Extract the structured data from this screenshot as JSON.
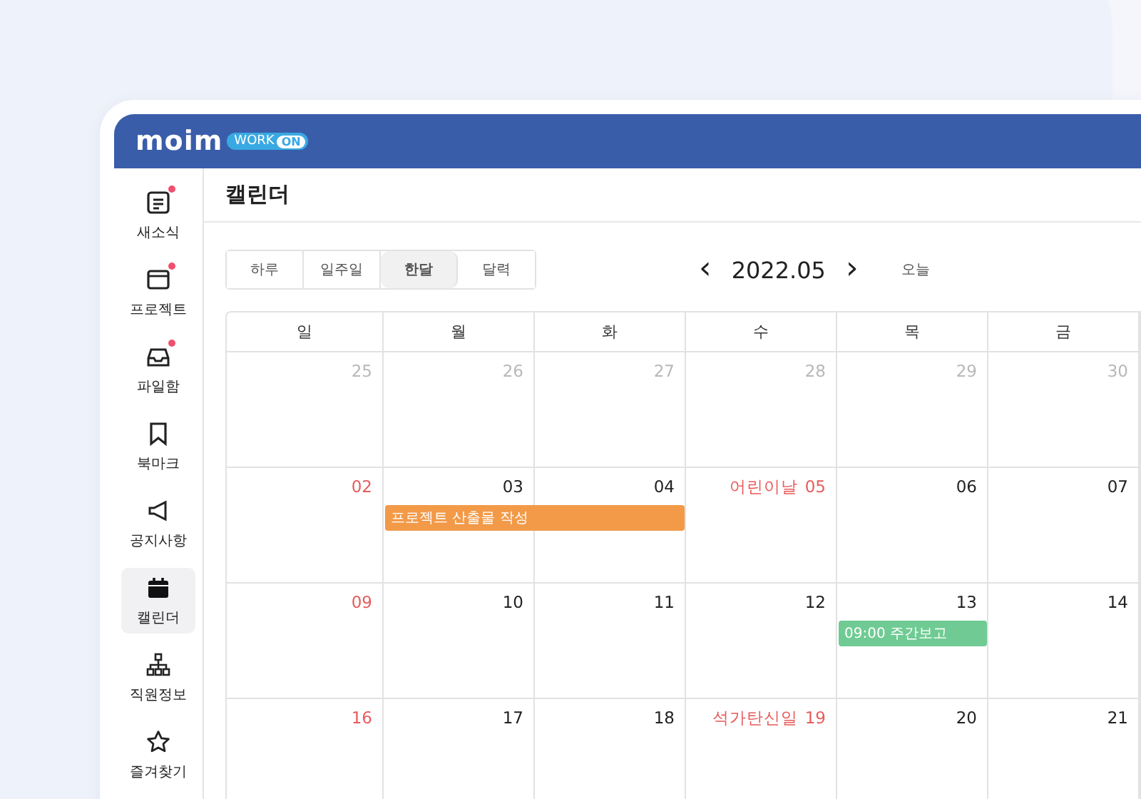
{
  "brand": {
    "name": "moim",
    "tag": "WORK",
    "tag_badge": "ON"
  },
  "sidebar": {
    "items": [
      {
        "label": "새소식",
        "badge": true,
        "selected": false
      },
      {
        "label": "프로젝트",
        "badge": true,
        "selected": false
      },
      {
        "label": "파일함",
        "badge": true,
        "selected": false
      },
      {
        "label": "북마크",
        "badge": false,
        "selected": false
      },
      {
        "label": "공지사항",
        "badge": false,
        "selected": false
      },
      {
        "label": "캘린더",
        "badge": false,
        "selected": true
      },
      {
        "label": "직원정보",
        "badge": false,
        "selected": false
      },
      {
        "label": "즐겨찾기",
        "badge": false,
        "selected": false
      }
    ]
  },
  "page_title": "캘린더",
  "view_tabs": [
    {
      "label": "하루",
      "selected": false
    },
    {
      "label": "일주일",
      "selected": false
    },
    {
      "label": "한달",
      "selected": true
    },
    {
      "label": "달력",
      "selected": false
    }
  ],
  "month_nav": {
    "prev": "‹",
    "month": "2022.05",
    "next": "›",
    "today": "오늘"
  },
  "calendar": {
    "weekdays": [
      "일",
      "월",
      "화",
      "수",
      "목",
      "금"
    ],
    "weeks": [
      {
        "days": [
          {
            "date": "25",
            "kind": "other_month"
          },
          {
            "date": "26",
            "kind": "other_month"
          },
          {
            "date": "27",
            "kind": "other_month"
          },
          {
            "date": "28",
            "kind": "other_month"
          },
          {
            "date": "29",
            "kind": "other_month"
          },
          {
            "date": "30",
            "kind": "other_month"
          }
        ]
      },
      {
        "days": [
          {
            "date": "02",
            "kind": "holiday"
          },
          {
            "date": "03",
            "kind": "normal",
            "event": {
              "text": "프로젝트 산출물 작성",
              "color": "#f29a48",
              "continues": true
            }
          },
          {
            "date": "04",
            "kind": "normal"
          },
          {
            "date": "05",
            "kind": "holiday",
            "holiday_name": "어린이날"
          },
          {
            "date": "06",
            "kind": "normal"
          },
          {
            "date": "07",
            "kind": "normal"
          }
        ]
      },
      {
        "days": [
          {
            "date": "09",
            "kind": "holiday"
          },
          {
            "date": "10",
            "kind": "normal"
          },
          {
            "date": "11",
            "kind": "normal"
          },
          {
            "date": "12",
            "kind": "normal"
          },
          {
            "date": "13",
            "kind": "normal",
            "event": {
              "text": "09:00 주간보고",
              "color": "#6fcb93",
              "continues": false
            }
          },
          {
            "date": "14",
            "kind": "normal"
          }
        ]
      },
      {
        "days": [
          {
            "date": "16",
            "kind": "holiday"
          },
          {
            "date": "17",
            "kind": "normal"
          },
          {
            "date": "18",
            "kind": "normal"
          },
          {
            "date": "19",
            "kind": "holiday",
            "holiday_name": "석가탄신일"
          },
          {
            "date": "20",
            "kind": "normal"
          },
          {
            "date": "21",
            "kind": "normal"
          }
        ]
      }
    ]
  }
}
